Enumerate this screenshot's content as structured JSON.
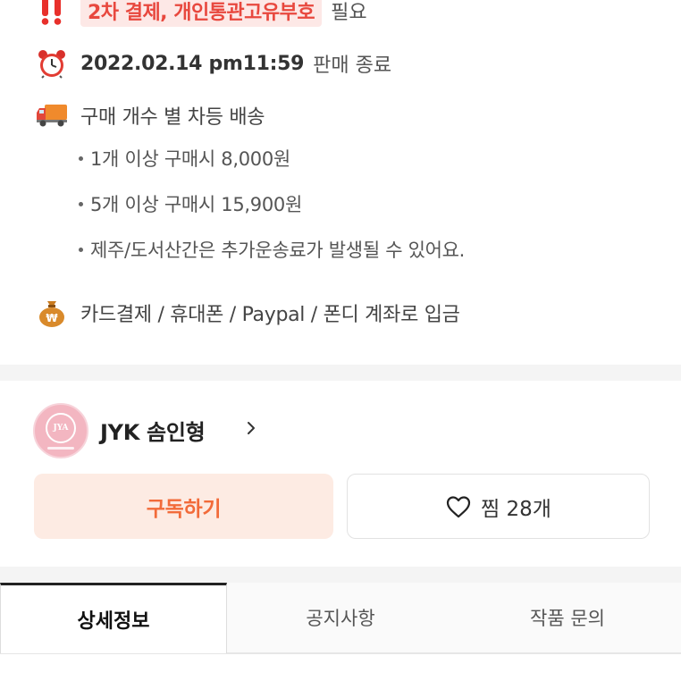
{
  "info": {
    "payment_notice": {
      "icon": "double-exclamation-icon",
      "highlight": "2차 결제, 개인통관고유부호",
      "suffix": "필요"
    },
    "deadline": {
      "icon": "alarm-clock-icon",
      "datetime": "2022.02.14 pm11:59",
      "suffix": "판매 종료"
    },
    "shipping": {
      "icon": "delivery-truck-icon",
      "title": "구매 개수 별 차등 배송",
      "bullets": [
        "1개 이상 구매시 8,000원",
        "5개 이상 구매시 15,900원",
        "제주/도서산간은 추가운송료가 발생될 수 있어요."
      ]
    },
    "payment_methods": {
      "icon": "money-bag-icon",
      "text": "카드결제 / 휴대폰 / Paypal / 폰디 계좌로 입금"
    }
  },
  "seller": {
    "avatar_text": "JYA",
    "name": "JYK 솜인형",
    "subscribe_label": "구독하기",
    "like_label": "찜 28개"
  },
  "tabs": [
    {
      "label": "상세정보",
      "active": true
    },
    {
      "label": "공지사항",
      "active": false
    },
    {
      "label": "작품 문의",
      "active": false
    }
  ],
  "colors": {
    "accent": "#f26b3a",
    "highlight_text": "#e8483e",
    "highlight_bg": "#fde8e6",
    "subscribe_bg": "#fdebe3"
  }
}
